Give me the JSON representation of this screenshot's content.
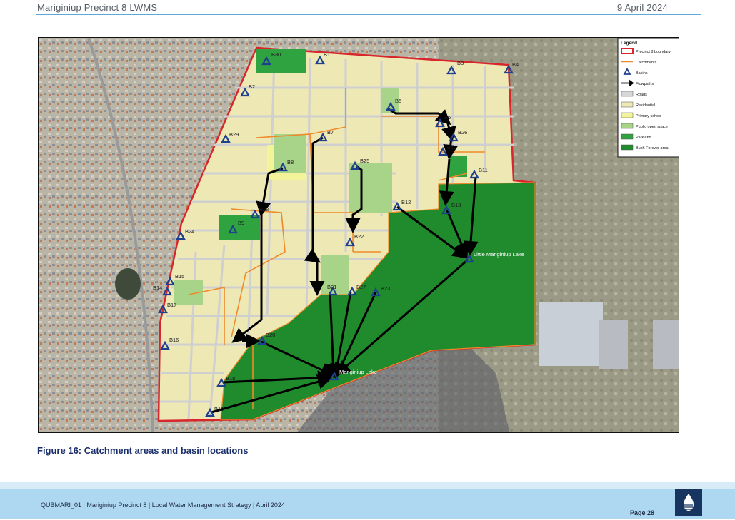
{
  "header": {
    "left": "Mariginiup Precinct 8 LWMS",
    "right": "9 April 2024"
  },
  "figure": {
    "caption": "Figure 16: Catchment areas and basin locations",
    "legend": {
      "title": "Legend",
      "items": [
        {
          "label": "Precinct 8 boundary",
          "kind": "boundary",
          "color": "#d9262c"
        },
        {
          "label": "Catchments",
          "kind": "line",
          "color": "#ef8a2a"
        },
        {
          "label": "Basins",
          "kind": "triangle",
          "color": "#1f3f8f"
        },
        {
          "label": "Flowpaths",
          "kind": "arrow",
          "color": "#000000"
        },
        {
          "label": "Roads",
          "kind": "fill",
          "color": "#d7d7d7"
        },
        {
          "label": "Residential",
          "kind": "fill",
          "color": "#eee8b5"
        },
        {
          "label": "Primary school",
          "kind": "fill",
          "color": "#f3f39a"
        },
        {
          "label": "Public open space",
          "kind": "fill",
          "color": "#a8d48a"
        },
        {
          "label": "Parkland",
          "kind": "fill",
          "color": "#2fa33f"
        },
        {
          "label": "Bush Forever area",
          "kind": "fill",
          "color": "#1f8b2d"
        }
      ]
    },
    "basins": [
      "B30",
      "B1",
      "B3",
      "B4",
      "B2",
      "B5",
      "B6",
      "B26",
      "B10",
      "B11",
      "B29",
      "B7",
      "B25",
      "B8",
      "B12",
      "B13",
      "B28",
      "B9",
      "B24",
      "B22",
      "B15",
      "B14",
      "B17",
      "B21",
      "B27",
      "B23",
      "B20",
      "B16",
      "B18",
      "B19"
    ],
    "lakes": [
      "Little Mariginiup Lake",
      "Mariginiup Lake"
    ]
  },
  "footer": {
    "text": "QUBMARI_01 | Mariginiup Precinct 8 | Local Water Management Strategy | April 2024",
    "page": "Page 28"
  },
  "logo": {
    "icon": "water-drop-icon"
  }
}
